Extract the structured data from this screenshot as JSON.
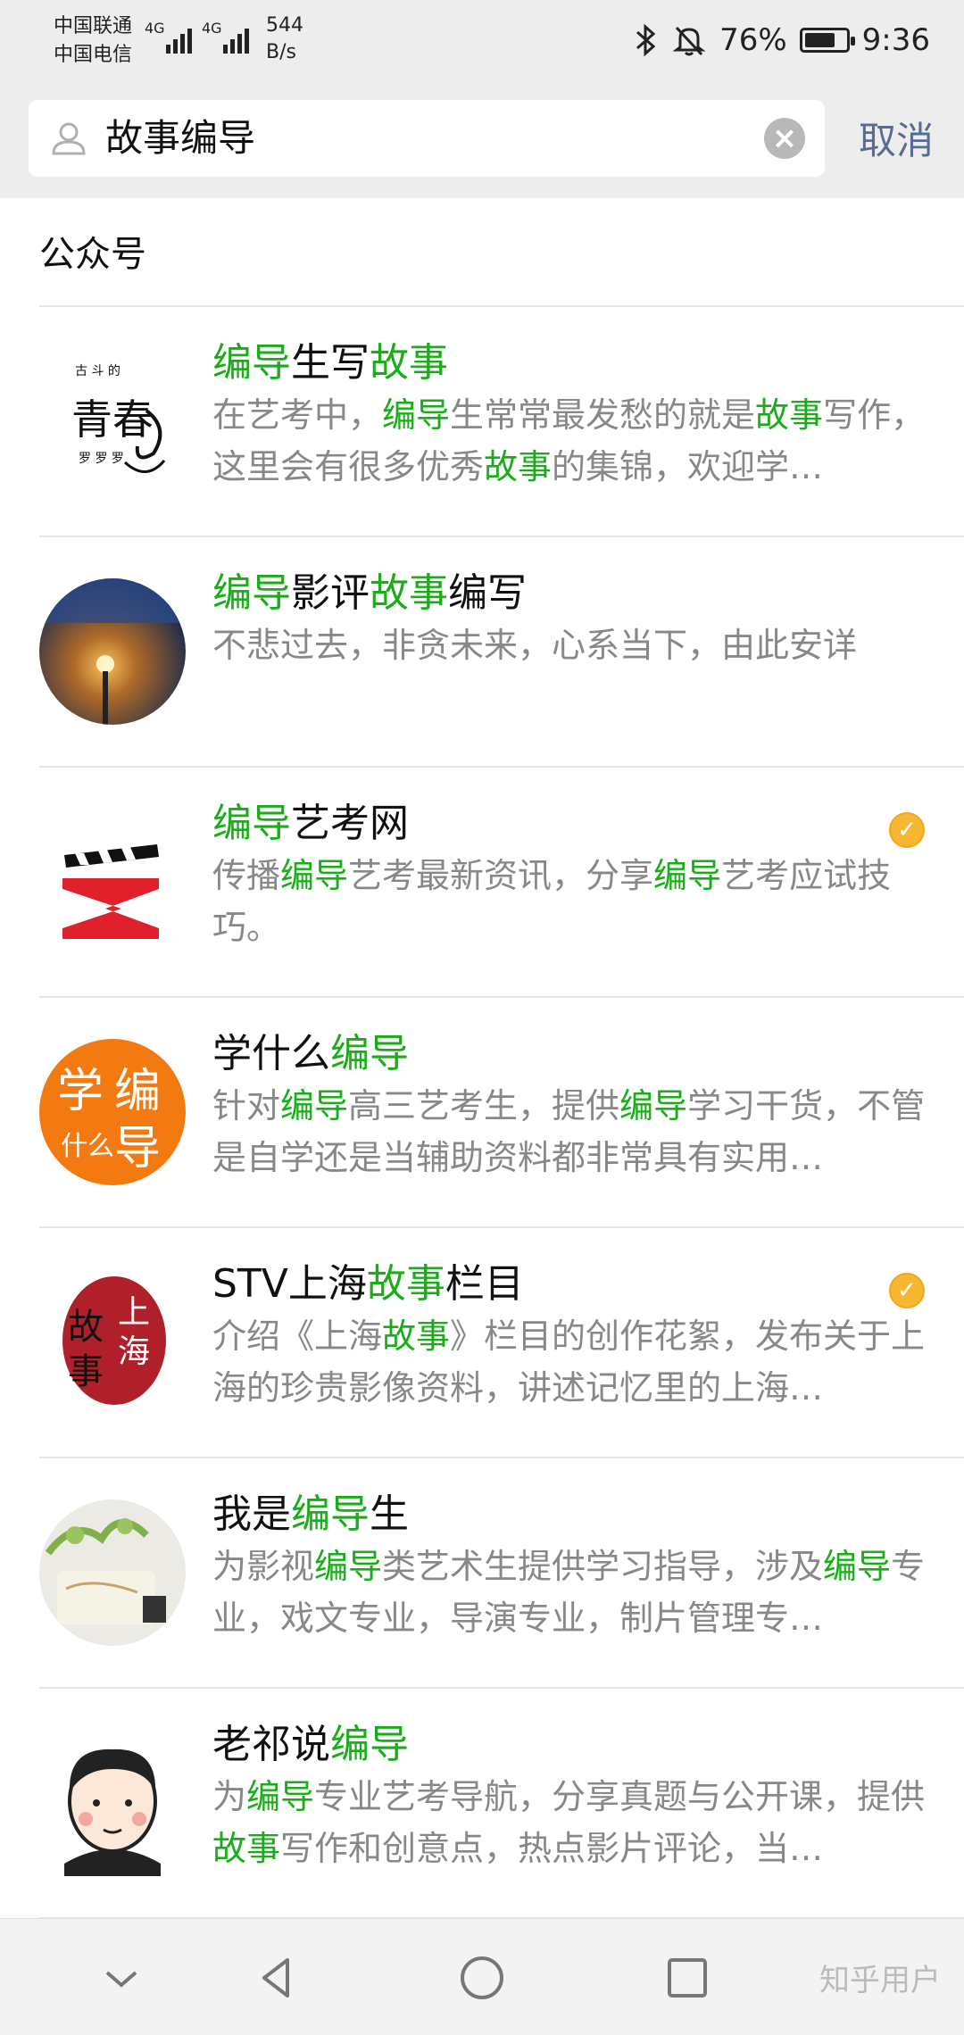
{
  "status_bar": {
    "carrier_1": "中国联通",
    "carrier_2": "中国电信",
    "net_1": "4G",
    "net_2": "4G",
    "speed_value": "544",
    "speed_unit": "B/s",
    "battery_percent": "76%",
    "battery_level": 0.76,
    "time": "9:36"
  },
  "search": {
    "query": "故事编导",
    "cancel_label": "取消"
  },
  "section_title": "公众号",
  "results": [
    {
      "name": [
        {
          "t": "编导",
          "h": true
        },
        {
          "t": "生写",
          "h": false
        },
        {
          "t": "故事",
          "h": true
        }
      ],
      "desc": [
        {
          "t": "在艺考中，",
          "h": false
        },
        {
          "t": "编导",
          "h": true
        },
        {
          "t": "生常常最发愁的就是",
          "h": false
        },
        {
          "t": "故事",
          "h": true
        },
        {
          "t": "写作，这里会有很多优秀",
          "h": false
        },
        {
          "t": "故事",
          "h": true
        },
        {
          "t": "的集锦，欢迎学…",
          "h": false
        }
      ],
      "verified": false,
      "avatar": "calligraphy-logo"
    },
    {
      "name": [
        {
          "t": "编导",
          "h": true
        },
        {
          "t": "影评",
          "h": false
        },
        {
          "t": "故事",
          "h": true
        },
        {
          "t": "编写",
          "h": false
        }
      ],
      "desc": [
        {
          "t": "不悲过去，非贪未来，心系当下，由此安详",
          "h": false
        }
      ],
      "verified": false,
      "avatar": "night-lamp-photo"
    },
    {
      "name": [
        {
          "t": "编导",
          "h": true
        },
        {
          "t": "艺考网",
          "h": false
        }
      ],
      "desc": [
        {
          "t": "传播",
          "h": false
        },
        {
          "t": "编导",
          "h": true
        },
        {
          "t": "艺考最新资讯，分享",
          "h": false
        },
        {
          "t": "编导",
          "h": true
        },
        {
          "t": "艺考应试技巧。",
          "h": false
        }
      ],
      "verified": true,
      "avatar": "clapperboard-logo"
    },
    {
      "name": [
        {
          "t": "学什么",
          "h": false
        },
        {
          "t": "编导",
          "h": true
        }
      ],
      "desc": [
        {
          "t": "针对",
          "h": false
        },
        {
          "t": "编导",
          "h": true
        },
        {
          "t": "高三艺考生，提供",
          "h": false
        },
        {
          "t": "编导",
          "h": true
        },
        {
          "t": "学习干货，不管是自学还是当辅助资料都非常具有实用…",
          "h": false
        }
      ],
      "verified": false,
      "avatar": "orange-circle-logo",
      "avatar_text": [
        "学",
        "编",
        "什么",
        "导"
      ]
    },
    {
      "name": [
        {
          "t": "STV上海",
          "h": false
        },
        {
          "t": "故事",
          "h": true
        },
        {
          "t": "栏目",
          "h": false
        }
      ],
      "desc": [
        {
          "t": "介绍《上海",
          "h": false
        },
        {
          "t": "故事",
          "h": true
        },
        {
          "t": "》栏目的创作花絮，发布关于上海的珍贵影像资料，讲述记忆里的上海…",
          "h": false
        }
      ],
      "verified": true,
      "avatar": "red-ink-logo"
    },
    {
      "name": [
        {
          "t": "我是",
          "h": false
        },
        {
          "t": "编导",
          "h": true
        },
        {
          "t": "生",
          "h": false
        }
      ],
      "desc": [
        {
          "t": "为影视",
          "h": false
        },
        {
          "t": "编导",
          "h": true
        },
        {
          "t": "类艺术生提供学习指导，涉及",
          "h": false
        },
        {
          "t": "编导",
          "h": true
        },
        {
          "t": "专业，戏文专业，导演专业，制片管理专…",
          "h": false
        }
      ],
      "verified": false,
      "avatar": "plant-photo"
    },
    {
      "name": [
        {
          "t": "老祁说",
          "h": false
        },
        {
          "t": "编导",
          "h": true
        }
      ],
      "desc": [
        {
          "t": "为",
          "h": false
        },
        {
          "t": "编导",
          "h": true
        },
        {
          "t": "专业艺考导航，分享真题与公开课，提供",
          "h": false
        },
        {
          "t": "故事",
          "h": true
        },
        {
          "t": "写作和创意点，热点影片评论，当…",
          "h": false
        }
      ],
      "verified": false,
      "avatar": "cartoon-man-avatar"
    }
  ],
  "watermark": "知乎用户",
  "colors": {
    "highlight": "#1aad19",
    "cancel": "#576b95",
    "verified": "#f7b733"
  }
}
